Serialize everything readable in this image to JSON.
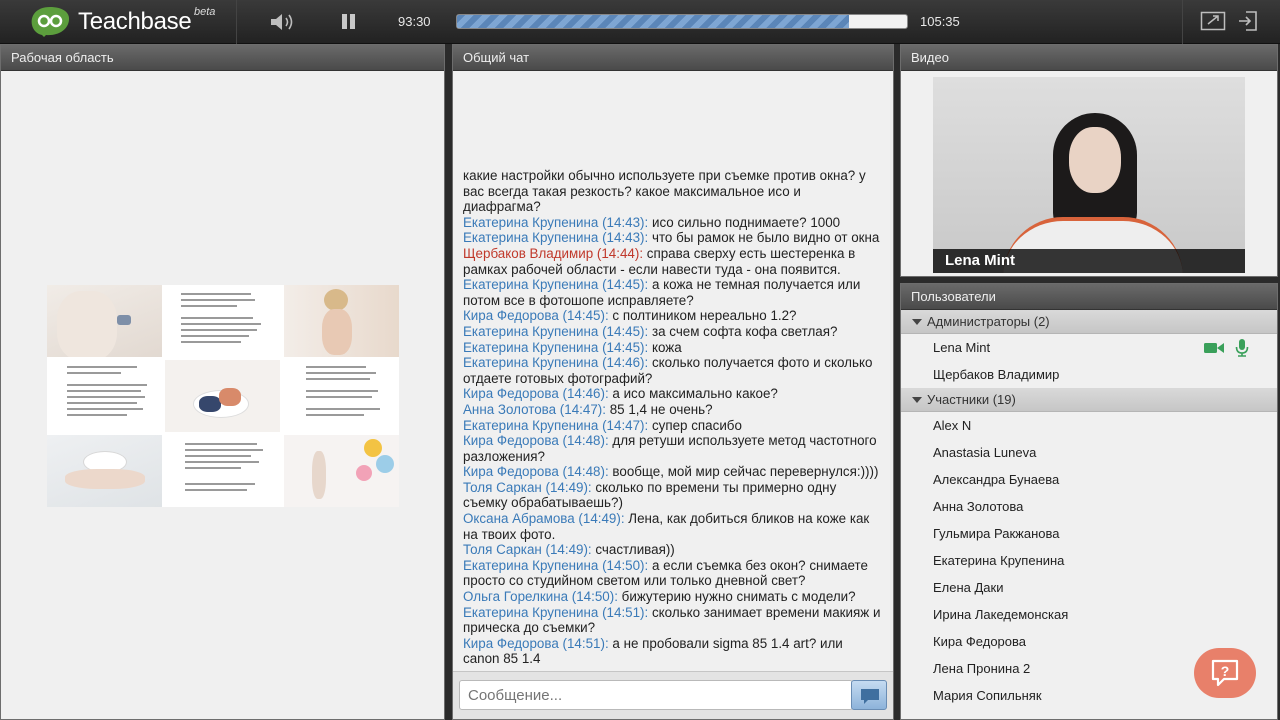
{
  "app": {
    "name": "Teachbase",
    "badge": "beta"
  },
  "player": {
    "current_time": "93:30",
    "total_time": "105:35",
    "progress": 0.87
  },
  "workspace": {
    "title": "Рабочая область"
  },
  "chat": {
    "title": "Общий чат",
    "input_placeholder": "Сообщение...",
    "messages": [
      {
        "author": "",
        "text": "какие настройки обычно используете при съемке против окна? у вас всегда такая резкость? какое максимальное исо и диафрагма?"
      },
      {
        "author": "Екатерина Крупенина (14:43):",
        "text": "исо сильно поднимаете? 1000"
      },
      {
        "author": "Екатерина Крупенина (14:43):",
        "text": "что бы рамок не было видно от окна"
      },
      {
        "author": "Щербаков Владимир (14:44):",
        "text": "справа сверху есть шестеренка в рамках рабочей области - если навести туда - она появится.",
        "highlight": true
      },
      {
        "author": "Екатерина Крупенина (14:45):",
        "text": "а кожа не темная получается или потом все в фотошопе исправляете?"
      },
      {
        "author": "Кира Федорова (14:45):",
        "text": "с полтиником нереально 1.2?"
      },
      {
        "author": "Екатерина Крупенина (14:45):",
        "text": "за счем софта кофа светлая?"
      },
      {
        "author": "Екатерина Крупенина (14:45):",
        "text": "кожа"
      },
      {
        "author": "Екатерина Крупенина (14:46):",
        "text": "сколько получается фото и сколько отдаете  готовых фотографий?"
      },
      {
        "author": "Кира Федорова (14:46):",
        "text": "а исо максимально какое?"
      },
      {
        "author": "Анна Золотова (14:47):",
        "text": "85 1,4 не очень?"
      },
      {
        "author": "Екатерина Крупенина (14:47):",
        "text": "супер спасибо"
      },
      {
        "author": "Кира Федорова (14:48):",
        "text": "для ретуши используете метод частотного разложения?"
      },
      {
        "author": "Кира Федорова (14:48):",
        "text": "вообще, мой мир сейчас перевернулся:))))"
      },
      {
        "author": "Толя Саркан (14:49):",
        "text": "сколько по времени ты примерно одну съемку обрабатываешь?)"
      },
      {
        "author": "Оксана Абрамова (14:49):",
        "text": "Лена, как добиться бликов на коже как на твоих фото."
      },
      {
        "author": "Толя Саркан (14:49):",
        "text": "счастливая))"
      },
      {
        "author": "Екатерина Крупенина (14:50):",
        "text": "а если съемка без окон? снимаете просто со студийном светом или только дневной свет?"
      },
      {
        "author": "Ольга Горелкина (14:50):",
        "text": "бижутерию нужно снимать с модели?"
      },
      {
        "author": "Екатерина Крупенина (14:51):",
        "text": "сколько занимает времени макияж и прическа до съемки?"
      },
      {
        "author": "Кира Федорова (14:51):",
        "text": "а не пробовали sigma 85 1.4 art? или canon 85 1.4"
      }
    ]
  },
  "video": {
    "title": "Видео",
    "speaker": "Lena  Mint"
  },
  "users": {
    "title": "Пользователи",
    "admins": {
      "label": "Администраторы (2)",
      "list": [
        "Lena  Mint",
        "Щербаков Владимир"
      ]
    },
    "participants": {
      "label": "Участники (19)",
      "list": [
        "Alex N",
        "Anastasia Luneva",
        "Александра Бунаева",
        "Анна Золотова",
        "Гульмира Ракжанова",
        "Екатерина Крупенина",
        "Елена Даки",
        "Ирина Лакедемонская",
        "Кира Федорова",
        "Лена Пронина 2",
        "Мария Сопильняк"
      ]
    }
  },
  "colors": {
    "author": "#3a7ab8",
    "author_highlight": "#c0392b",
    "progress": "#5b86b8",
    "help": "#e8806a"
  },
  "icons": [
    "volume-icon",
    "pause-icon",
    "fullscreen-icon",
    "exit-icon",
    "send-icon",
    "camera-icon",
    "microphone-icon",
    "help-chat-icon"
  ]
}
